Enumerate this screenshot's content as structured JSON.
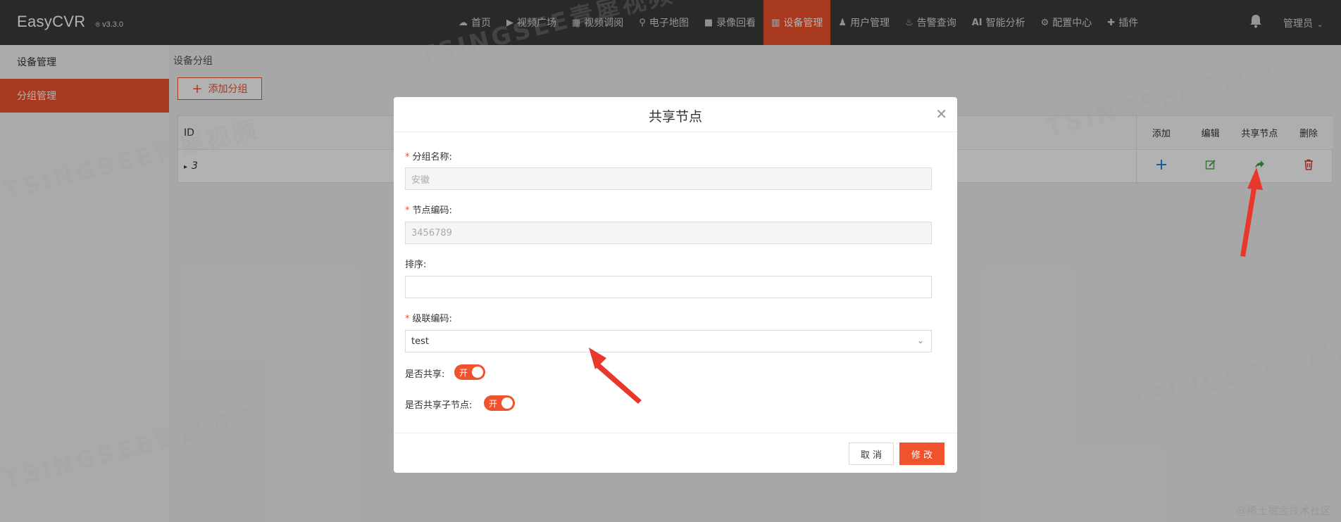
{
  "header": {
    "app_name": "EasyCVR",
    "version": "v3.3.0",
    "version_mark": "®",
    "nav": [
      {
        "label": "首页",
        "icon": "cloud-icon"
      },
      {
        "label": "视频广场",
        "icon": "play-icon"
      },
      {
        "label": "视频调阅",
        "icon": "grid-icon"
      },
      {
        "label": "电子地图",
        "icon": "location-pin-icon"
      },
      {
        "label": "录像回看",
        "icon": "video-camera-icon"
      },
      {
        "label": "设备管理",
        "icon": "device-grid-icon",
        "active": true
      },
      {
        "label": "用户管理",
        "icon": "user-icon"
      },
      {
        "label": "告警查询",
        "icon": "alarm-icon"
      },
      {
        "label": "智能分析",
        "icon": "ai-icon",
        "icon_text": "AI"
      },
      {
        "label": "配置中心",
        "icon": "gear-icon"
      },
      {
        "label": "插件",
        "icon": "puzzle-icon"
      }
    ],
    "user_label": "管理员"
  },
  "sidebar": {
    "items": [
      {
        "label": "设备管理"
      },
      {
        "label": "分组管理",
        "active": true
      }
    ]
  },
  "main": {
    "breadcrumb": "设备分组",
    "add_button": "添加分组",
    "table": {
      "id_header": "ID",
      "row_id": "3",
      "op_headers": [
        "添加",
        "编辑",
        "共享节点",
        "删除"
      ]
    }
  },
  "modal": {
    "title": "共享节点",
    "fields": {
      "group_name_label": "分组名称:",
      "group_name_value": "安徽",
      "node_code_label": "节点编码:",
      "node_code_value": "3456789",
      "sort_label": "排序:",
      "sort_value": "",
      "cascade_code_label": "级联编码:",
      "cascade_code_value": "test",
      "share_label": "是否共享:",
      "share_on_text": "开",
      "share_children_label": "是否共享子节点:",
      "share_children_on_text": "开"
    },
    "cancel_label": "取 消",
    "ok_label": "修 改"
  },
  "watermark_text": "TSINGSEE青犀视频",
  "credit": "@稀土掘金技术社区",
  "colors": {
    "accent": "#f0522d",
    "topbar": "#3b3b3b",
    "add_op": "#1e88e5",
    "edit_op": "#4caf50",
    "share_op": "#43a047",
    "delete_op": "#e53935",
    "annotation_arrow": "#e8382c"
  }
}
